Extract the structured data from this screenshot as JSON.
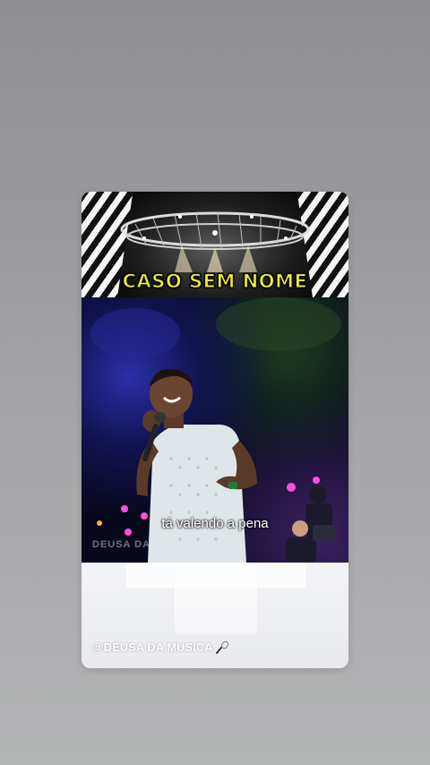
{
  "story": {
    "header_title": "CASO SEM NOME",
    "subtitle": "tá valendo a pena",
    "watermark": "DEUSA DA",
    "mention": "@DEUSA DA MUSICA",
    "mention_icon": "microphone-icon"
  },
  "colors": {
    "background_top": "#8f8e91",
    "background_bottom": "#b3b4b5",
    "title_yellow": "#f2ee2c",
    "stage_blue": "#2a2fa8",
    "performer_shirt": "#dfe6ea",
    "stage_light_pink": "#ff4fd8"
  }
}
